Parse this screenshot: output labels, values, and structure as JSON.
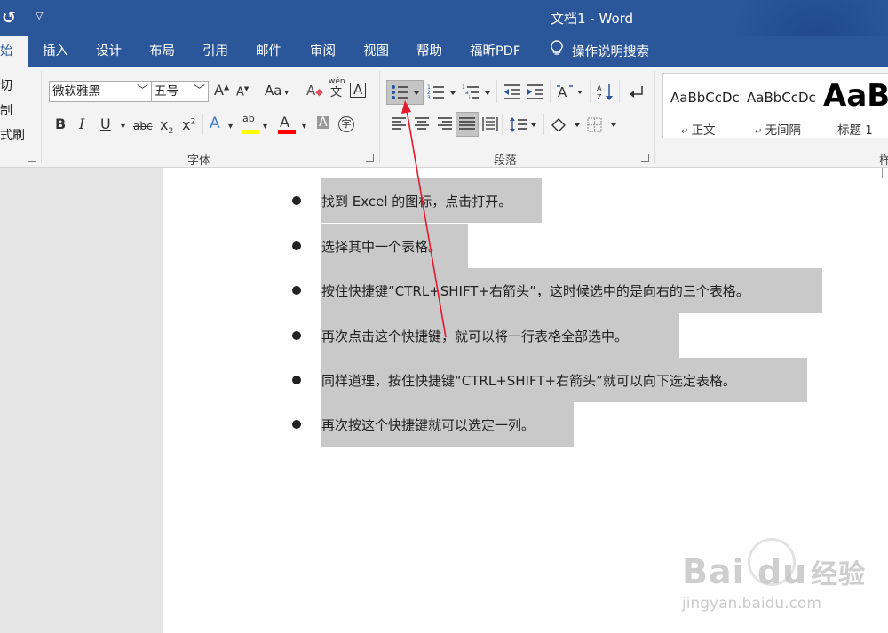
{
  "window": {
    "title": "文档1 - Word"
  },
  "quick_access": {
    "undo_glyph": "↺",
    "more_glyph": "▽"
  },
  "tabs": [
    {
      "label": "开始",
      "visible": "始",
      "active": true
    },
    {
      "label": "插入"
    },
    {
      "label": "设计"
    },
    {
      "label": "布局"
    },
    {
      "label": "引用"
    },
    {
      "label": "邮件"
    },
    {
      "label": "审阅"
    },
    {
      "label": "视图"
    },
    {
      "label": "帮助"
    },
    {
      "label": "福昕PDF"
    },
    {
      "label": "操作说明搜索"
    }
  ],
  "clipboard": {
    "cut": "切",
    "copy": "制",
    "format_painter": "式刷"
  },
  "font": {
    "name": "微软雅黑",
    "size": "五号",
    "group_label": "字体",
    "grow": "A",
    "shrink": "A",
    "change_case": "Aa",
    "clear_format": "A",
    "phonetic_top": "wén",
    "phonetic_bottom": "文",
    "char_border": "A",
    "bold": "B",
    "italic": "I",
    "underline": "U",
    "strikethrough": "abc",
    "subscript": "x",
    "superscript": "x",
    "text_effects": "A",
    "highlight": "ab",
    "font_color": "A",
    "char_shading": "A",
    "enclose": "字",
    "highlight_color": "#ffff00",
    "font_color_bar": "#ff0000"
  },
  "paragraph": {
    "group_label": "段落"
  },
  "styles": [
    {
      "sample": "AaBbCcDc",
      "name": "正文"
    },
    {
      "sample": "AaBbCcDc",
      "name": "无间隔"
    },
    {
      "sample": "AaBb",
      "name": "标题 1"
    }
  ],
  "styles_group_label": "样",
  "document": {
    "bullets": [
      "找到 Excel 的图标，点击打开。",
      "选择其中一个表格。",
      "按住快捷键“CTRL+SHIFT+右箭头”，这时候选中的是向右的三个表格。",
      "再次点击这个快捷键，就可以将一行表格全部选中。",
      "同样道理，按住快捷键“CTRL+SHIFT+右箭头”就可以向下选定表格。",
      "再次按这个快捷键就可以选定一列。"
    ]
  },
  "watermark": {
    "brand": "Bai du",
    "brand_cn": "经验",
    "sub": "jingyan.baidu.com"
  },
  "colors": {
    "ribbon_blue": "#2b579a",
    "selection_gray": "#c9c9c9",
    "annotation_red": "#e5192e"
  }
}
